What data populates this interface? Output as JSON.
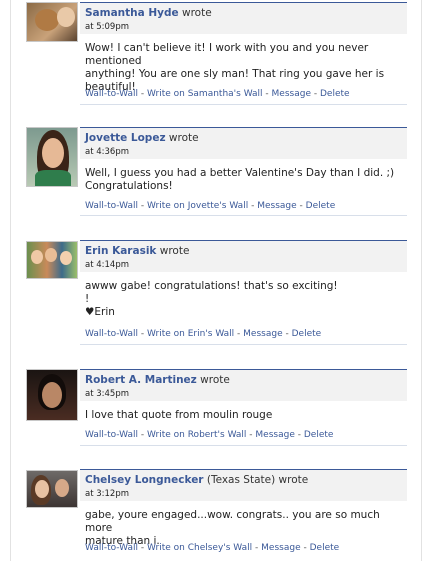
{
  "actions_common": {
    "wall_to_wall": "Wall-to-Wall",
    "message": "Message",
    "delete": "Delete",
    "separator": "-"
  },
  "posts": [
    {
      "name": "Samantha Hyde",
      "network": "",
      "wrote": "wrote",
      "time": "at 5:09pm",
      "lines": [
        "Wow! I can't believe it! I work with you and you never mentioned",
        "anything! You are one sly man! That ring you gave her is",
        "beautiful!"
      ],
      "write_on": "Write on Samantha's Wall"
    },
    {
      "name": "Jovette Lopez",
      "network": "",
      "wrote": "wrote",
      "time": "at 4:36pm",
      "lines": [
        "Well, I guess you had a better Valentine's Day than I did. ;)",
        "Congratulations!"
      ],
      "write_on": "Write on Jovette's Wall"
    },
    {
      "name": "Erin Karasik",
      "network": "",
      "wrote": "wrote",
      "time": "at 4:14pm",
      "lines": [
        "awww gabe! congratulations! that's so exciting!",
        "!",
        "♥Erin"
      ],
      "write_on": "Write on Erin's Wall"
    },
    {
      "name": "Robert A. Martinez",
      "network": "",
      "wrote": "wrote",
      "time": "at 3:45pm",
      "lines": [
        "I love that quote from moulin rouge"
      ],
      "write_on": "Write on Robert's Wall"
    },
    {
      "name": "Chelsey Longnecker",
      "network": "(Texas State)",
      "wrote": "wrote",
      "time": "at 3:12pm",
      "lines": [
        "gabe, youre engaged...wow. congrats.. you are so much more",
        "mature than i."
      ],
      "write_on": "Write on Chelsey's Wall"
    }
  ]
}
